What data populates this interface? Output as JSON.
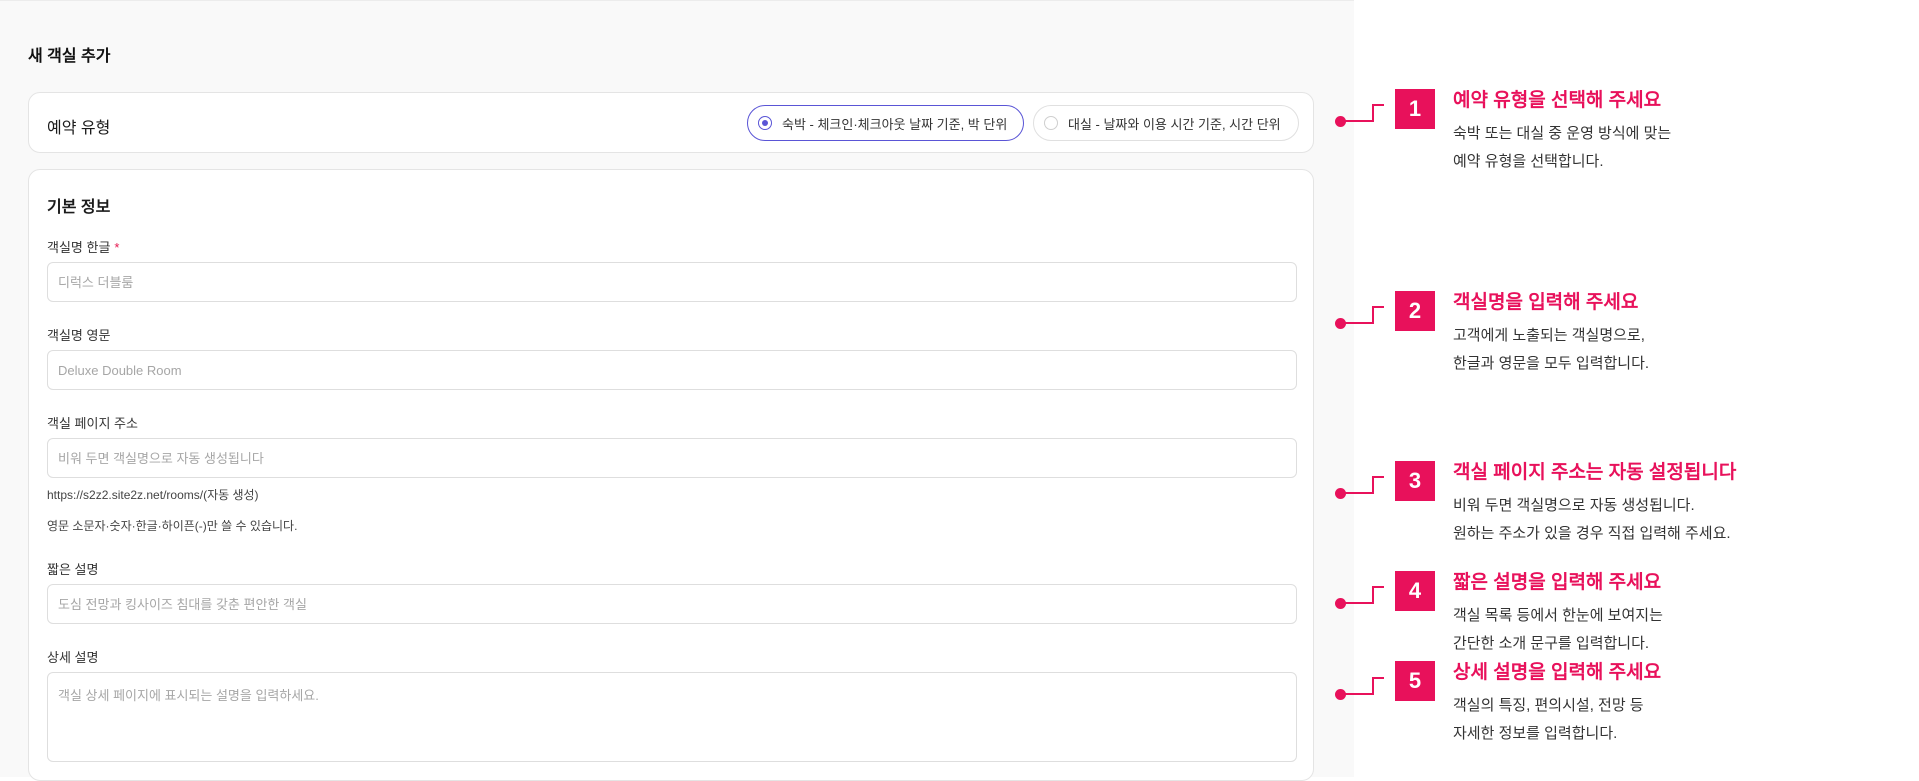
{
  "page": {
    "title": "새 객실 추가"
  },
  "reservation_type": {
    "label": "예약 유형",
    "options": [
      {
        "label": "숙박 - 체크인·체크아웃 날짜 기준, 박 단위",
        "selected": true
      },
      {
        "label": "대실 - 날짜와 이용 시간 기준, 시간 단위",
        "selected": false
      }
    ]
  },
  "basic_info": {
    "title": "기본 정보",
    "name_ko": {
      "label": "객실명 한글",
      "required_mark": "*",
      "placeholder": "디럭스 더블룸",
      "value": ""
    },
    "name_en": {
      "label": "객실명 영문",
      "placeholder": "Deluxe Double Room",
      "value": ""
    },
    "slug": {
      "label": "객실 페이지 주소",
      "placeholder": "비워 두면 객실명으로 자동 생성됩니다",
      "value": "",
      "url_preview": "https://s2z2.site2z.net/rooms/(자동 생성)",
      "rule": "영문 소문자·숫자·한글·하이픈(-)만 쓸 수 있습니다."
    },
    "short_desc": {
      "label": "짧은 설명",
      "placeholder": "도심 전망과 킹사이즈 침대를 갖춘 편안한 객실",
      "value": ""
    },
    "long_desc": {
      "label": "상세 설명",
      "placeholder": "객실 상세 페이지에 표시되는 설명을 입력하세요.",
      "value": ""
    }
  },
  "annotations": [
    {
      "number": "1",
      "title": "예약 유형을 선택해 주세요",
      "lines": [
        "숙박 또는 대실 중 운영 방식에 맞는",
        "예약 유형을 선택합니다."
      ]
    },
    {
      "number": "2",
      "title": "객실명을 입력해 주세요",
      "lines": [
        "고객에게 노출되는 객실명으로,",
        "한글과 영문을 모두 입력합니다."
      ]
    },
    {
      "number": "3",
      "title": "객실 페이지 주소는 자동 설정됩니다",
      "lines": [
        "비워 두면 객실명으로 자동 생성됩니다.",
        "원하는 주소가 있을 경우 직접 입력해 주세요."
      ]
    },
    {
      "number": "4",
      "title": "짧은 설명을 입력해 주세요",
      "lines": [
        "객실 목록 등에서 한눈에 보여지는",
        "간단한 소개 문구를 입력합니다."
      ]
    },
    {
      "number": "5",
      "title": "상세 설명을 입력해 주세요",
      "lines": [
        "객실의 특징, 편의시설, 전망 등",
        "자세한 정보를 입력합니다."
      ]
    }
  ],
  "colors": {
    "accent": "#e8115b",
    "radio_selected": "#5a55d6"
  }
}
